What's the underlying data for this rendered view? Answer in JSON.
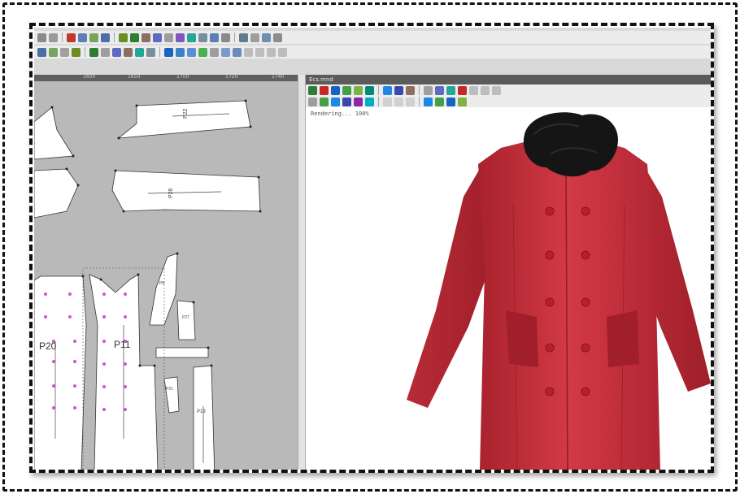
{
  "render_window": {
    "title": "Ecs.mnd",
    "status_text": "Rendering... 100%"
  },
  "ruler_ticks": [
    "1600",
    "1650",
    "1700",
    "1720",
    "1740"
  ],
  "pattern_pieces": {
    "p20_label": "P20",
    "p11_label": "P11",
    "p8_label": "P8",
    "p22_label": "P22",
    "p26_label": "P26",
    "p27_label": "P27",
    "p21_label": "P21",
    "p19_label": "P19"
  },
  "colors": {
    "coat_red": "#c8323d",
    "collar_fur": "#151515",
    "pattern_background": "#b9b9b9",
    "notch_marker": "#d64fd6"
  },
  "icons": [
    "undo-icon",
    "redo-icon",
    "cut-icon",
    "copy-icon",
    "paste-icon",
    "render-icon",
    "save-icon",
    "zoom-icon",
    "layers-icon",
    "settings-icon"
  ]
}
